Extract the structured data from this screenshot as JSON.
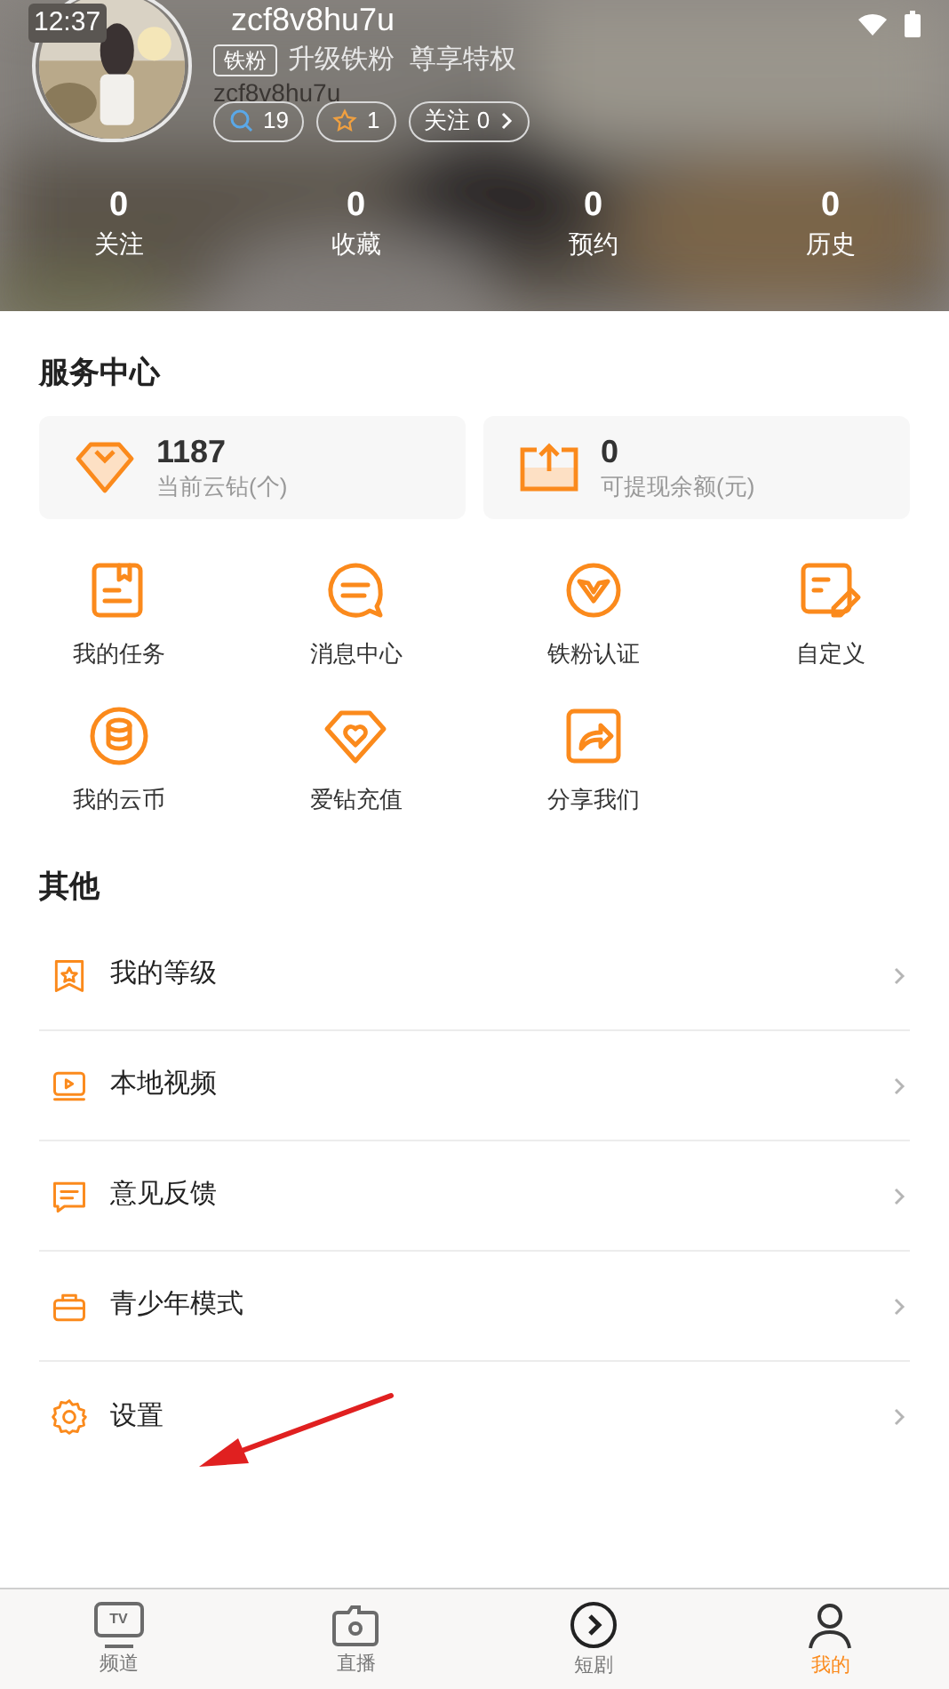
{
  "status_bar": {
    "time": "12:37"
  },
  "profile": {
    "username": "zcf8v8hu7u",
    "username_shadow": "zcf8v8hu7u",
    "fan_badge": "铁粉",
    "upgrade_text": "升级铁粉  尊享特权",
    "chips": [
      {
        "kind": "search",
        "text": "19"
      },
      {
        "kind": "star",
        "text": "1"
      },
      {
        "kind": "follow",
        "text": "关注 0"
      }
    ]
  },
  "stats": [
    {
      "value": "0",
      "label": "关注"
    },
    {
      "value": "0",
      "label": "收藏"
    },
    {
      "value": "0",
      "label": "预约"
    },
    {
      "value": "0",
      "label": "历史"
    }
  ],
  "service_center": {
    "title": "服务中心",
    "balances": [
      {
        "kind": "diamond",
        "value": "1187",
        "label": "当前云钻(个)"
      },
      {
        "kind": "withdraw",
        "value": "0",
        "label": "可提现余额(元)"
      }
    ],
    "shortcuts": [
      {
        "kind": "task",
        "label": "我的任务"
      },
      {
        "kind": "message",
        "label": "消息中心"
      },
      {
        "kind": "verify",
        "label": "铁粉认证"
      },
      {
        "kind": "edit",
        "label": "自定义"
      },
      {
        "kind": "coin",
        "label": "我的云币"
      },
      {
        "kind": "heart",
        "label": "爱钻充值"
      },
      {
        "kind": "share",
        "label": "分享我们"
      }
    ]
  },
  "other": {
    "title": "其他",
    "items": [
      {
        "kind": "level",
        "label": "我的等级"
      },
      {
        "kind": "video",
        "label": "本地视频"
      },
      {
        "kind": "feedback",
        "label": "意见反馈"
      },
      {
        "kind": "teen",
        "label": "青少年模式"
      },
      {
        "kind": "settings",
        "label": "设置"
      }
    ]
  },
  "bottom_nav": [
    {
      "kind": "tv",
      "icon_text": "TV",
      "label": "频道",
      "selected": false
    },
    {
      "kind": "live",
      "label": "直播",
      "selected": false
    },
    {
      "kind": "play",
      "label": "短剧",
      "selected": false
    },
    {
      "kind": "user",
      "label": "我的",
      "selected": true
    }
  ]
}
